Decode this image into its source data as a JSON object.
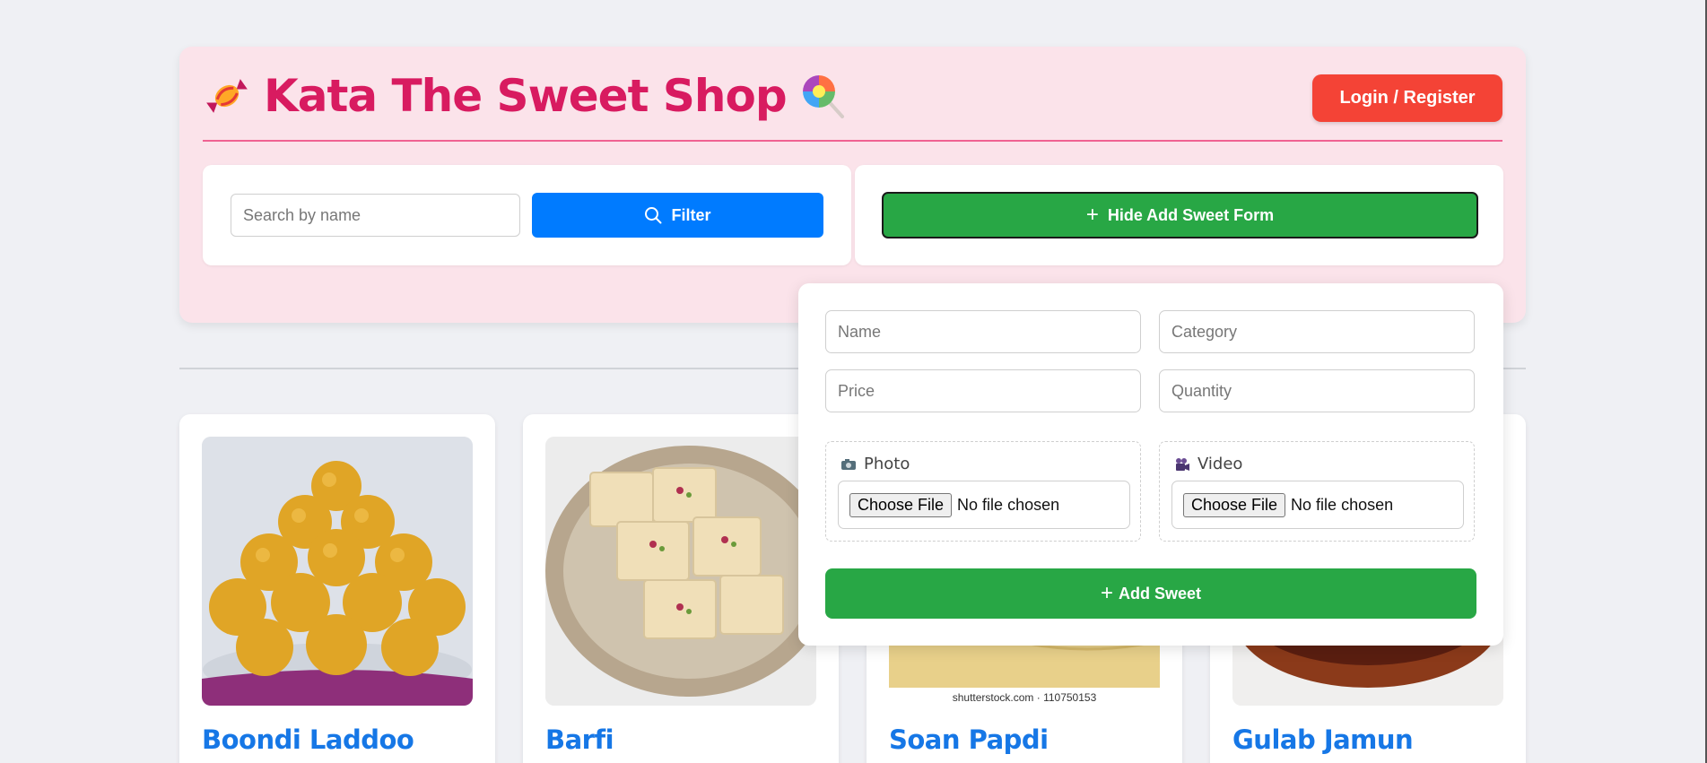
{
  "header": {
    "title": "Kata The Sweet Shop",
    "login_label": "Login / Register",
    "candy_icon": "candy-icon",
    "lollipop_icon": "lollipop-icon"
  },
  "search": {
    "placeholder": "Search by name",
    "filter_label": "Filter",
    "icon": "search-icon"
  },
  "toggle_form": {
    "label": "Hide Add Sweet Form",
    "icon": "plus-icon"
  },
  "add_form": {
    "name_placeholder": "Name",
    "category_placeholder": "Category",
    "price_placeholder": "Price",
    "quantity_placeholder": "Quantity",
    "photo_label": "Photo",
    "photo_icon": "camera-icon",
    "video_label": "Video",
    "video_icon": "video-camera-icon",
    "choose_file_label": "Choose File",
    "no_file_text": "No file chosen",
    "submit_label": "Add Sweet"
  },
  "sweets": [
    {
      "name": "Boondi Laddoo"
    },
    {
      "name": "Barfi"
    },
    {
      "name": "Soan Papdi",
      "watermark": "shutterstock.com · 110750153"
    },
    {
      "name": "Gulab Jamun"
    }
  ],
  "colors": {
    "title": "#d81b60",
    "login": "#f44336",
    "filter": "#007bff",
    "add": "#28a745",
    "card_title": "#1677e6",
    "header_bg": "#fbe3ea"
  }
}
